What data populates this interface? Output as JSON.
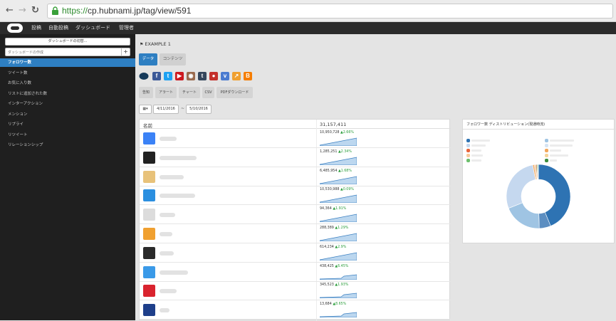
{
  "browser": {
    "url_scheme": "https://",
    "url_rest": "cp.hubnami.jp/tag/view/591"
  },
  "appbar": {
    "nav": [
      "投稿",
      "自動投稿",
      "ダッシュボード",
      "管理者"
    ]
  },
  "sidebar": {
    "dashboard_switch": "ダッシュボードの切替...",
    "create_placeholder": "ダッシュボードの作成",
    "plus": "+",
    "items": [
      {
        "label": "フォロワー数",
        "active": true
      },
      {
        "label": "ツイート数"
      },
      {
        "label": "お気に入り数"
      },
      {
        "label": "リストに追加された数"
      },
      {
        "label": "インターアクション"
      },
      {
        "label": "メンション"
      },
      {
        "label": "リプライ"
      },
      {
        "label": "リツイート"
      },
      {
        "label": "リレーションシップ"
      }
    ]
  },
  "main": {
    "tag_title": "EXAMPLE 1",
    "tabs": [
      "データ",
      "コンテンツ"
    ],
    "actions": [
      "告知",
      "アラート",
      "チャート",
      "CSV",
      "PDFダウンロード"
    ],
    "date_from": "4/11/2016",
    "date_sep": "~",
    "date_to": "5/10/2016",
    "calendar_icon": "calendar-icon",
    "table": {
      "col_name": "名前",
      "col_total": "31,157,411",
      "rows": [
        {
          "value": "10,950,728",
          "delta": "2.66%"
        },
        {
          "value": "1,285,251",
          "delta": "2.34%"
        },
        {
          "value": "6,485,954",
          "delta": "1.68%"
        },
        {
          "value": "10,530,988",
          "delta": "0.09%"
        },
        {
          "value": "94,364",
          "delta": "1.91%"
        },
        {
          "value": "288,389",
          "delta": "1.29%"
        },
        {
          "value": "614,234",
          "delta": "2.9%"
        },
        {
          "value": "438,425",
          "delta": "6.45%"
        },
        {
          "value": "345,523",
          "delta": "1.93%"
        },
        {
          "value": "13,684",
          "delta": "8.65%"
        }
      ]
    }
  },
  "distribution_panel": {
    "title": "フォロワー数 ディストリビューション(現通時流)"
  },
  "colors": {
    "accent": "#2e7fc2",
    "sidebar_bg": "#1f1f1f",
    "appbar_bg": "#2b2b2b",
    "up": "#2a9d3a"
  },
  "chart_data": {
    "type": "pie",
    "values": [
      45,
      6,
      20,
      29,
      0.8,
      0.9,
      0.5,
      0.4,
      0.3
    ],
    "colors": [
      "#2e73b3",
      "#5c8ec1",
      "#9fc4e3",
      "#c5d8ef",
      "#f2a65a",
      "#f7c99b",
      "#a05a2c",
      "#6cbf6c",
      "#3e8e3e"
    ]
  }
}
